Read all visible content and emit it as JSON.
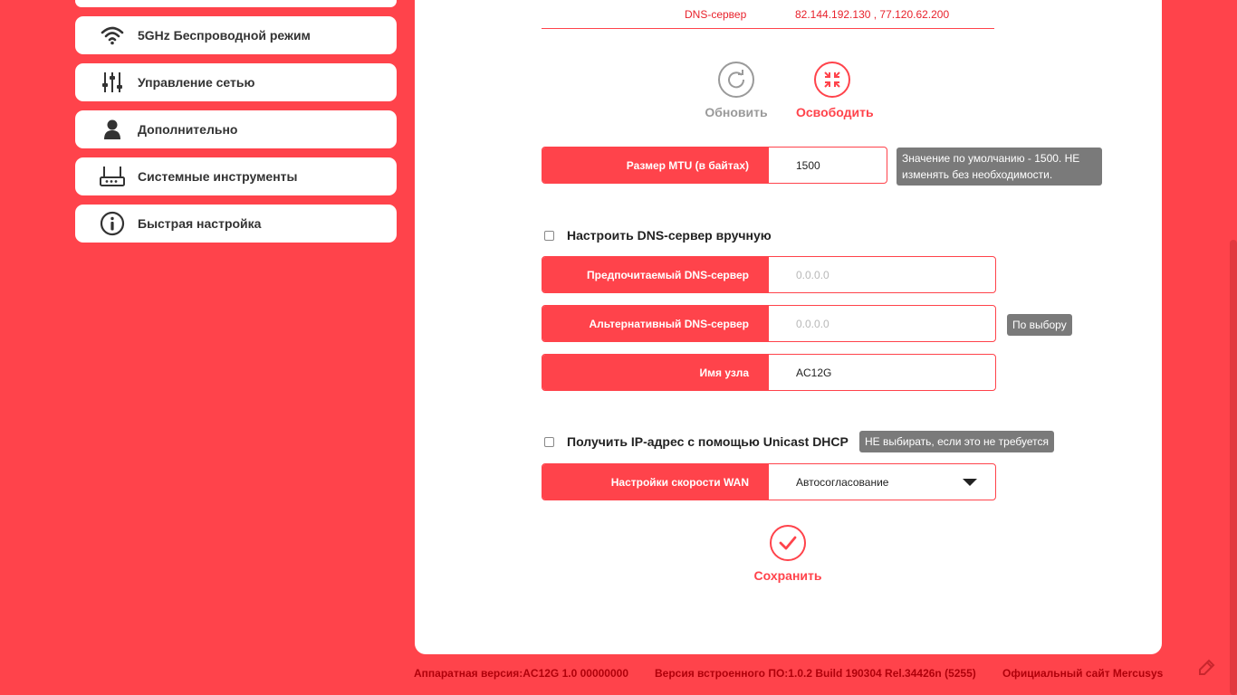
{
  "sidebar": {
    "items": [
      {
        "label": "5GHz Беспроводной режим",
        "icon": "wifi-icon"
      },
      {
        "label": "Управление сетью",
        "icon": "sliders-icon"
      },
      {
        "label": "Дополнительно",
        "icon": "user-icon"
      },
      {
        "label": "Системные инструменты",
        "icon": "router-icon"
      },
      {
        "label": "Быстрая настройка",
        "icon": "info-icon"
      }
    ]
  },
  "dns_info": {
    "label": "DNS-сервер",
    "value": "82.144.192.130 , 77.120.62.200"
  },
  "actions": {
    "refresh": "Обновить",
    "release": "Освободить"
  },
  "mtu": {
    "label": "Размер MTU (в байтах)",
    "value": "1500",
    "tip": "Значение по умолчанию - 1500. НЕ изменять без необходимости."
  },
  "dns_manual": {
    "label": "Настроить DNS-сервер вручную",
    "checked": false
  },
  "preferred_dns": {
    "label": "Предпочитаемый DNS-сервер",
    "placeholder": "0.0.0.0"
  },
  "alternate_dns": {
    "label": "Альтернативный DNS-сервер",
    "placeholder": "0.0.0.0",
    "tip": "По выбору"
  },
  "hostname": {
    "label": "Имя узла",
    "value": "AC12G"
  },
  "unicast": {
    "label": "Получить IP-адрес с помощью Unicast DHCP",
    "checked": false,
    "tip": "НЕ выбирать, если это не требуется"
  },
  "wan_speed": {
    "label": "Настройки скорости WAN",
    "value": "Автосогласование"
  },
  "save": {
    "label": "Сохранить"
  },
  "footer": {
    "hardware": "Аппаратная версия:AC12G 1.0 00000000",
    "firmware": "Версия встроенного ПО:1.0.2 Build 190304 Rel.34426n (5255)",
    "site": "Официальный сайт Mercusys"
  },
  "colors": {
    "accent": "#ff434b",
    "tip_bg": "#7a7a7a"
  }
}
